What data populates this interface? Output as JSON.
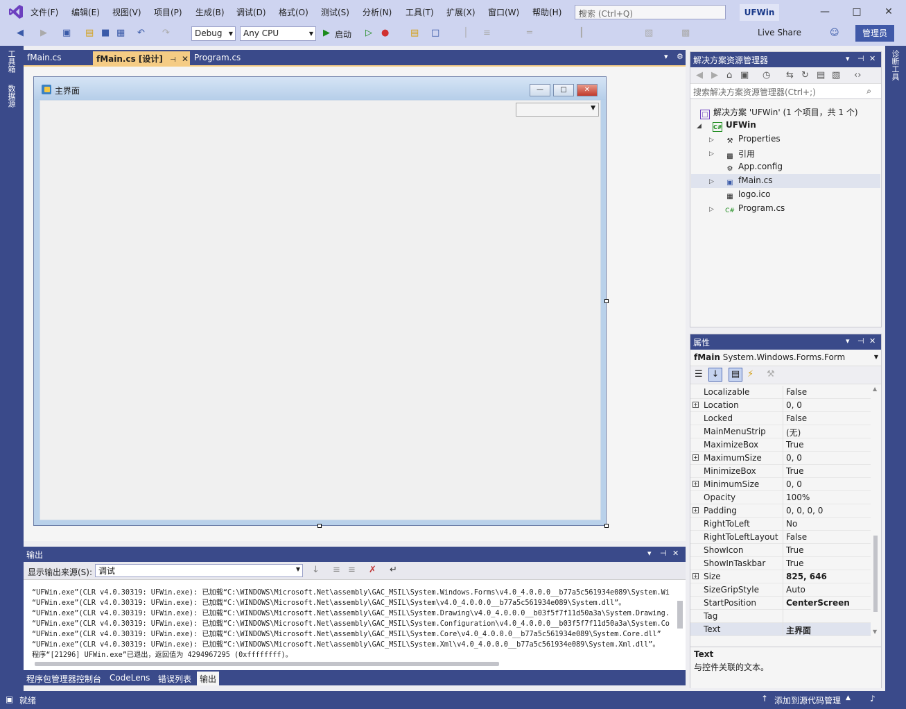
{
  "app": {
    "solution_name": "UFWin"
  },
  "menu": [
    "文件(F)",
    "编辑(E)",
    "视图(V)",
    "项目(P)",
    "生成(B)",
    "调试(D)",
    "格式(O)",
    "测试(S)",
    "分析(N)",
    "工具(T)",
    "扩展(X)",
    "窗口(W)",
    "帮助(H)"
  ],
  "search": {
    "placeholder": "搜索 (Ctrl+Q)"
  },
  "toolbar": {
    "config": "Debug",
    "platform": "Any CPU",
    "start_label": "启动",
    "live_share": "Live Share",
    "admin": "管理员"
  },
  "left_strip": [
    "工具箱",
    "数据源"
  ],
  "right_strip": [
    "诊断工具"
  ],
  "doc_tabs": [
    {
      "label": "fMain.cs"
    },
    {
      "label": "fMain.cs [设计]",
      "active": true
    },
    {
      "label": "Program.cs"
    }
  ],
  "designer": {
    "form_title": "主界面"
  },
  "output": {
    "title": "输出",
    "source_label": "显示输出来源(S):",
    "source_value": "调试",
    "lines": [
      "“UFWin.exe”(CLR v4.0.30319: UFWin.exe): 已加载“C:\\WINDOWS\\Microsoft.Net\\assembly\\GAC_MSIL\\System.Windows.Forms\\v4.0_4.0.0.0__b77a5c561934e089\\System.Wi",
      "“UFWin.exe”(CLR v4.0.30319: UFWin.exe): 已加载“C:\\WINDOWS\\Microsoft.Net\\assembly\\GAC_MSIL\\System\\v4.0_4.0.0.0__b77a5c561934e089\\System.dll”。",
      "“UFWin.exe”(CLR v4.0.30319: UFWin.exe): 已加载“C:\\WINDOWS\\Microsoft.Net\\assembly\\GAC_MSIL\\System.Drawing\\v4.0_4.0.0.0__b03f5f7f11d50a3a\\System.Drawing.",
      "“UFWin.exe”(CLR v4.0.30319: UFWin.exe): 已加载“C:\\WINDOWS\\Microsoft.Net\\assembly\\GAC_MSIL\\System.Configuration\\v4.0_4.0.0.0__b03f5f7f11d50a3a\\System.Co",
      "“UFWin.exe”(CLR v4.0.30319: UFWin.exe): 已加载“C:\\WINDOWS\\Microsoft.Net\\assembly\\GAC_MSIL\\System.Core\\v4.0_4.0.0.0__b77a5c561934e089\\System.Core.dll”",
      "“UFWin.exe”(CLR v4.0.30319: UFWin.exe): 已加载“C:\\WINDOWS\\Microsoft.Net\\assembly\\GAC_MSIL\\System.Xml\\v4.0_4.0.0.0__b77a5c561934e089\\System.Xml.dll”。",
      "程序“[21296] UFWin.exe”已退出，返回值为 4294967295 (0xffffffff)。"
    ]
  },
  "bottom_tabs": [
    "程序包管理器控制台",
    "CodeLens",
    "错误列表",
    "输出"
  ],
  "status": {
    "ready": "就绪",
    "source_control": "添加到源代码管理"
  },
  "solution_explorer": {
    "title": "解决方案资源管理器",
    "search_placeholder": "搜索解决方案资源管理器(Ctrl+;)",
    "items": [
      {
        "label": "解决方案 'UFWin' (1 个项目，共 1 个)"
      },
      {
        "label": "UFWin"
      },
      {
        "label": "Properties"
      },
      {
        "label": "引用"
      },
      {
        "label": "App.config"
      },
      {
        "label": "fMain.cs"
      },
      {
        "label": "logo.ico"
      },
      {
        "label": "Program.cs"
      }
    ]
  },
  "properties": {
    "title": "属性",
    "object_name": "fMain",
    "object_type": "System.Windows.Forms.Form",
    "rows": [
      {
        "name": "Localizable",
        "value": "False"
      },
      {
        "name": "Location",
        "value": "0, 0"
      },
      {
        "name": "Locked",
        "value": "False"
      },
      {
        "name": "MainMenuStrip",
        "value": "(无)"
      },
      {
        "name": "MaximizeBox",
        "value": "True"
      },
      {
        "name": "MaximumSize",
        "value": "0, 0"
      },
      {
        "name": "MinimizeBox",
        "value": "True"
      },
      {
        "name": "MinimumSize",
        "value": "0, 0"
      },
      {
        "name": "Opacity",
        "value": "100%"
      },
      {
        "name": "Padding",
        "value": "0, 0, 0, 0"
      },
      {
        "name": "RightToLeft",
        "value": "No"
      },
      {
        "name": "RightToLeftLayout",
        "value": "False"
      },
      {
        "name": "ShowIcon",
        "value": "True"
      },
      {
        "name": "ShowInTaskbar",
        "value": "True"
      },
      {
        "name": "Size",
        "value": "825, 646"
      },
      {
        "name": "SizeGripStyle",
        "value": "Auto"
      },
      {
        "name": "StartPosition",
        "value": "CenterScreen"
      },
      {
        "name": "Tag",
        "value": ""
      },
      {
        "name": "Text",
        "value": "主界面"
      }
    ],
    "desc_title": "Text",
    "desc_text": "与控件关联的文本。"
  }
}
